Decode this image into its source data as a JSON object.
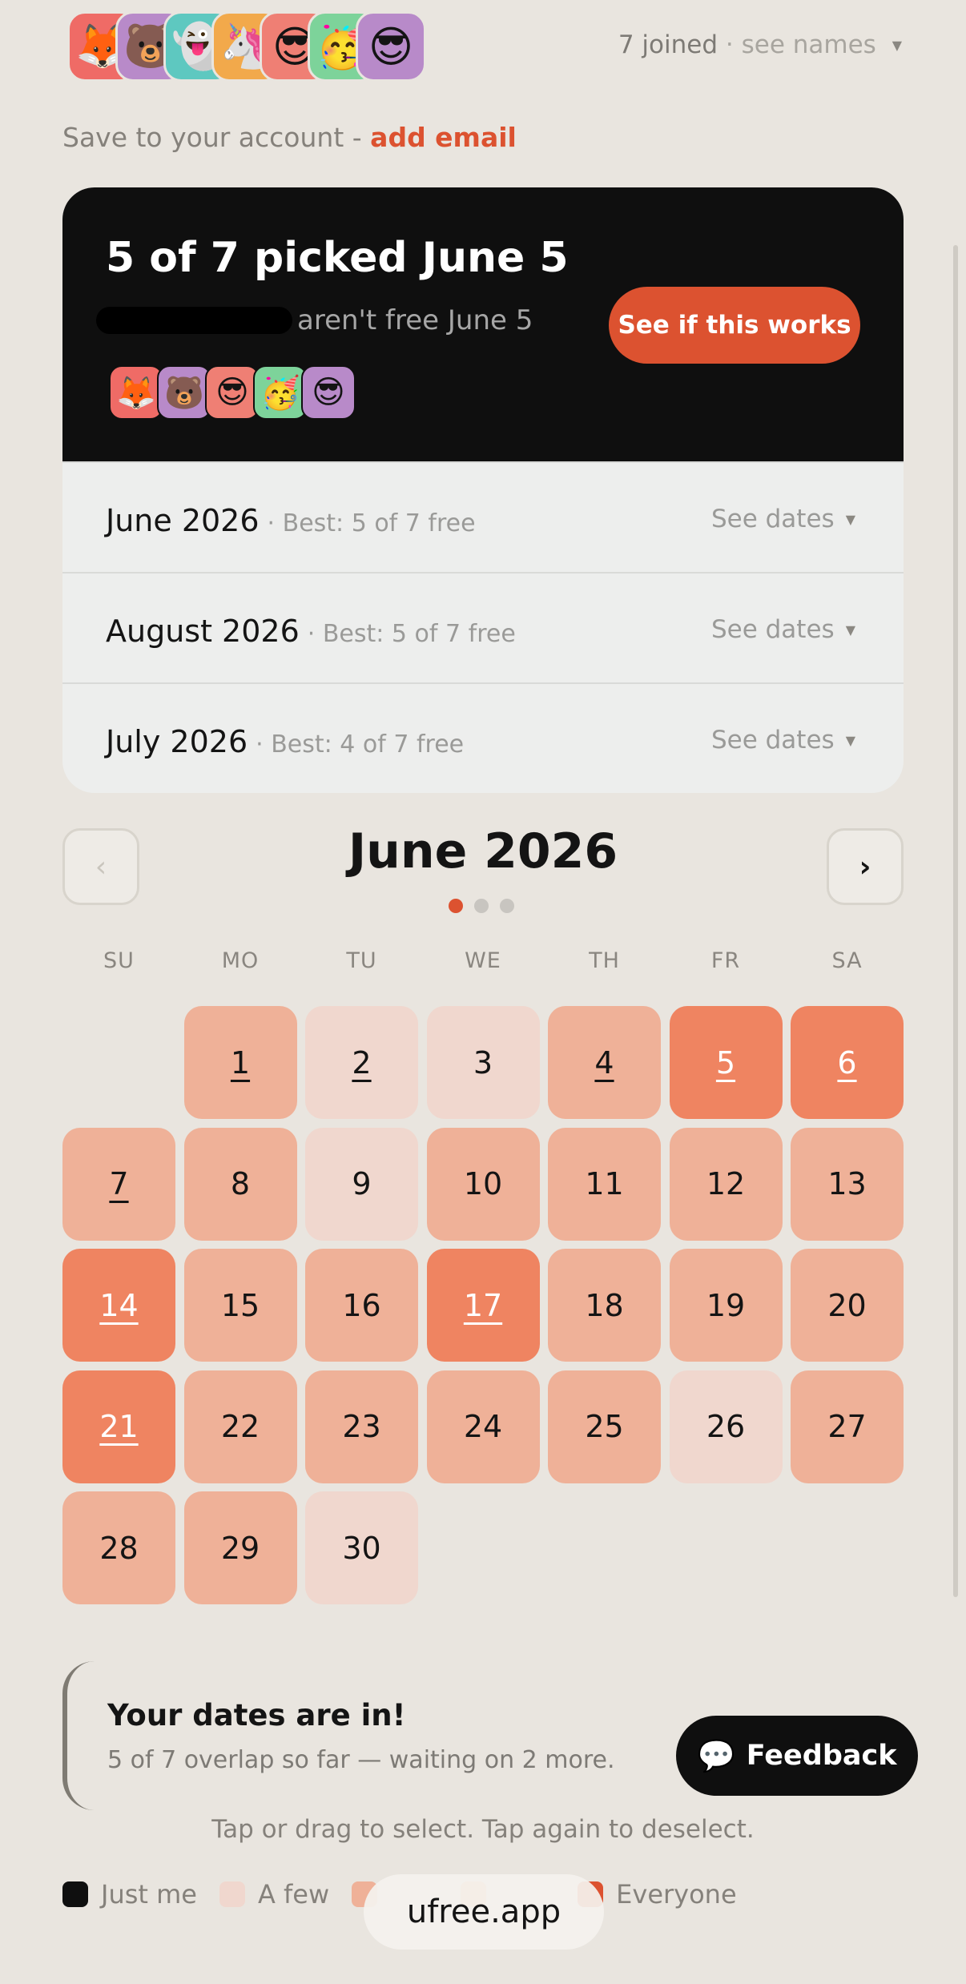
{
  "header": {
    "avatars": [
      "🦊",
      "🐻",
      "👻",
      "🦄",
      "😎",
      "🥳",
      "😎"
    ],
    "avatar_colors": [
      "#ef6b66",
      "#b88ac9",
      "#5ec8c0",
      "#f2a94b",
      "#ef7f74",
      "#7dd39a",
      "#b88ac9"
    ],
    "joined_label": "7 joined",
    "see_names_label": "· see names",
    "chevron": "▼"
  },
  "save": {
    "prefix": "Save to your account -",
    "link": "add email"
  },
  "result": {
    "title": "5 of 7 picked June 5",
    "subtitle_suffix": "aren't free June 5",
    "button_label": "See if this works",
    "voters": [
      "🦊",
      "🐻",
      "😎",
      "🥳",
      "😎"
    ],
    "voter_colors": [
      "#ef6b66",
      "#b88ac9",
      "#ef7f74",
      "#7dd39a",
      "#b88ac9"
    ],
    "months": [
      {
        "name": "June 2026",
        "best": "· Best: 5 of 7 free",
        "see": "See dates"
      },
      {
        "name": "August 2026",
        "best": "· Best: 5 of 7 free",
        "see": "See dates"
      },
      {
        "name": "July 2026",
        "best": "· Best: 4 of 7 free",
        "see": "See dates"
      }
    ]
  },
  "calendar": {
    "title": "June 2026",
    "prev_label": "‹",
    "next_label": "›",
    "page_count": 3,
    "active_page": 0,
    "weekdays": [
      "SU",
      "MO",
      "TU",
      "WE",
      "TH",
      "FR",
      "SA"
    ],
    "first_weekday": 1,
    "days": [
      {
        "d": "1",
        "level": 2,
        "u": true
      },
      {
        "d": "2",
        "level": 1,
        "u": true
      },
      {
        "d": "3",
        "level": 1,
        "u": false
      },
      {
        "d": "4",
        "level": 2,
        "u": true
      },
      {
        "d": "5",
        "level": 3,
        "u": true
      },
      {
        "d": "6",
        "level": 3,
        "u": true
      },
      {
        "d": "7",
        "level": 2,
        "u": true
      },
      {
        "d": "8",
        "level": 2,
        "u": false
      },
      {
        "d": "9",
        "level": 1,
        "u": false
      },
      {
        "d": "10",
        "level": 2,
        "u": false
      },
      {
        "d": "11",
        "level": 2,
        "u": false
      },
      {
        "d": "12",
        "level": 2,
        "u": false
      },
      {
        "d": "13",
        "level": 2,
        "u": false
      },
      {
        "d": "14",
        "level": 3,
        "u": true
      },
      {
        "d": "15",
        "level": 2,
        "u": false
      },
      {
        "d": "16",
        "level": 2,
        "u": false
      },
      {
        "d": "17",
        "level": 3,
        "u": true
      },
      {
        "d": "18",
        "level": 2,
        "u": false
      },
      {
        "d": "19",
        "level": 2,
        "u": false
      },
      {
        "d": "20",
        "level": 2,
        "u": false
      },
      {
        "d": "21",
        "level": 3,
        "u": true
      },
      {
        "d": "22",
        "level": 2,
        "u": false
      },
      {
        "d": "23",
        "level": 2,
        "u": false
      },
      {
        "d": "24",
        "level": 2,
        "u": false
      },
      {
        "d": "25",
        "level": 2,
        "u": false
      },
      {
        "d": "26",
        "level": 1,
        "u": false
      },
      {
        "d": "27",
        "level": 2,
        "u": false
      },
      {
        "d": "28",
        "level": 2,
        "u": false
      },
      {
        "d": "29",
        "level": 2,
        "u": false
      },
      {
        "d": "30",
        "level": 1,
        "u": false
      }
    ]
  },
  "note": {
    "title": "Your dates are in!",
    "subtitle": "5 of 7 overlap so far — waiting on 2 more."
  },
  "feedback": {
    "icon": "💬",
    "label": "Feedback"
  },
  "hint": "Tap or drag to select. Tap again to deselect.",
  "legend": {
    "just_me": "Just me",
    "a_few": "A few",
    "everyone": "Everyone"
  },
  "domain": "ufree.app"
}
